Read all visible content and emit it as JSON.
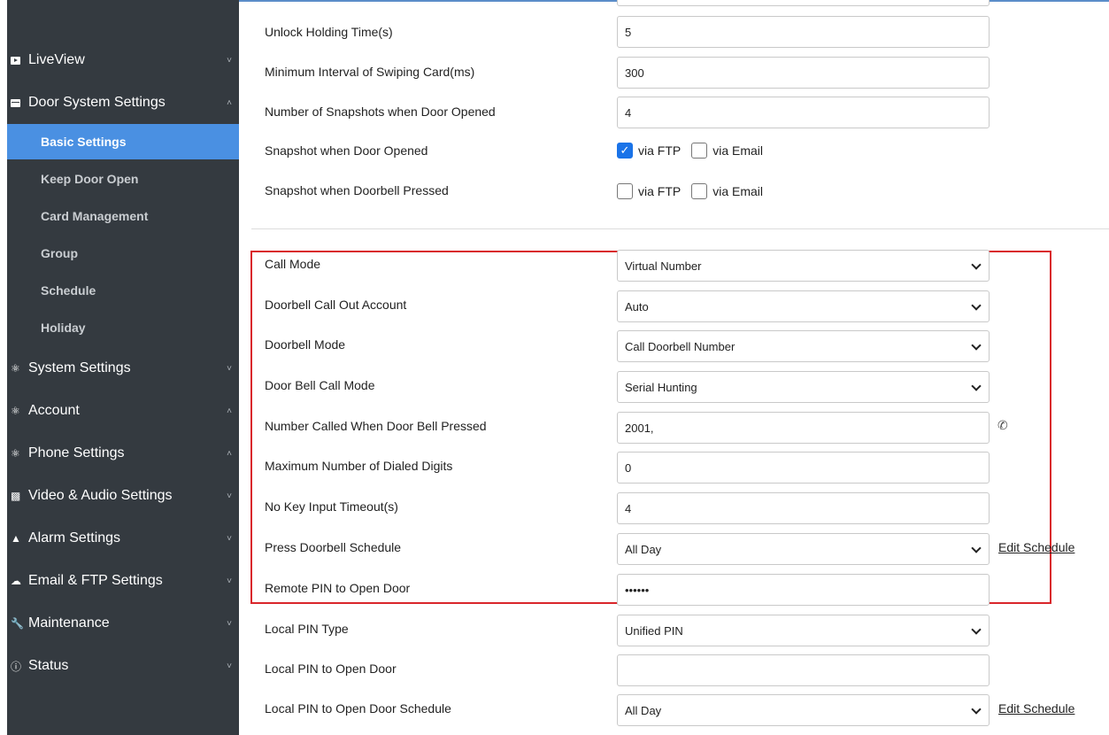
{
  "sidebar": {
    "items": [
      {
        "label": "LiveView",
        "icon": "video-play-icon",
        "chevron": "˅"
      },
      {
        "label": "Door System Settings",
        "icon": "panel-icon",
        "chevron": "˄"
      },
      {
        "label": "System Settings",
        "icon": "key-icon",
        "chevron": "˅"
      },
      {
        "label": "Account",
        "icon": "key-icon",
        "chevron": "˄"
      },
      {
        "label": "Phone Settings",
        "icon": "key-icon",
        "chevron": "˄"
      },
      {
        "label": "Video & Audio Settings",
        "icon": "camera-icon",
        "chevron": "˅"
      },
      {
        "label": "Alarm Settings",
        "icon": "bell-icon",
        "chevron": "˅"
      },
      {
        "label": "Email & FTP Settings",
        "icon": "cloud-icon",
        "chevron": "˅"
      },
      {
        "label": "Maintenance",
        "icon": "wrench-icon",
        "chevron": "˅"
      },
      {
        "label": "Status",
        "icon": "info-icon",
        "chevron": "˅"
      }
    ],
    "subitems": [
      "Basic Settings",
      "Keep Door Open",
      "Card Management",
      "Group",
      "Schedule",
      "Holiday"
    ],
    "active_subitem": "Basic Settings"
  },
  "form": {
    "unlock_holding_time": {
      "label": "Unlock Holding Time(s)",
      "value": "5"
    },
    "min_interval_swiping": {
      "label": "Minimum Interval of Swiping Card(ms)",
      "value": "300"
    },
    "num_snapshots": {
      "label": "Number of Snapshots when Door Opened",
      "value": "4"
    },
    "snapshot_door_opened": {
      "label": "Snapshot when Door Opened",
      "ftp_label": "via FTP",
      "ftp_checked": true,
      "email_label": "via Email",
      "email_checked": false
    },
    "snapshot_doorbell": {
      "label": "Snapshot when Doorbell Pressed",
      "ftp_label": "via FTP",
      "ftp_checked": false,
      "email_label": "via Email",
      "email_checked": false
    },
    "call_mode": {
      "label": "Call Mode",
      "value": "Virtual Number"
    },
    "doorbell_call_out_account": {
      "label": "Doorbell Call Out Account",
      "value": "Auto"
    },
    "doorbell_mode": {
      "label": "Doorbell Mode",
      "value": "Call Doorbell Number"
    },
    "door_bell_call_mode": {
      "label": "Door Bell Call Mode",
      "value": "Serial Hunting"
    },
    "number_called": {
      "label": "Number Called When Door Bell Pressed",
      "value": "2001,"
    },
    "max_dialed_digits": {
      "label": "Maximum Number of Dialed Digits",
      "value": "0"
    },
    "no_key_timeout": {
      "label": "No Key Input Timeout(s)",
      "value": "4"
    },
    "press_doorbell_schedule": {
      "label": "Press Doorbell Schedule",
      "value": "All Day",
      "link": "Edit Schedule"
    },
    "remote_pin": {
      "label": "Remote PIN to Open Door",
      "value": "••••••"
    },
    "local_pin_type": {
      "label": "Local PIN Type",
      "value": "Unified PIN"
    },
    "local_pin": {
      "label": "Local PIN to Open Door",
      "value": ""
    },
    "local_pin_schedule": {
      "label": "Local PIN to Open Door Schedule",
      "value": "All Day",
      "link": "Edit Schedule"
    }
  },
  "colors": {
    "sidebar_bg": "#343a40",
    "active_bg": "#4a90e2",
    "highlight_border": "#d9262b",
    "checkbox_checked": "#1a73e8"
  }
}
